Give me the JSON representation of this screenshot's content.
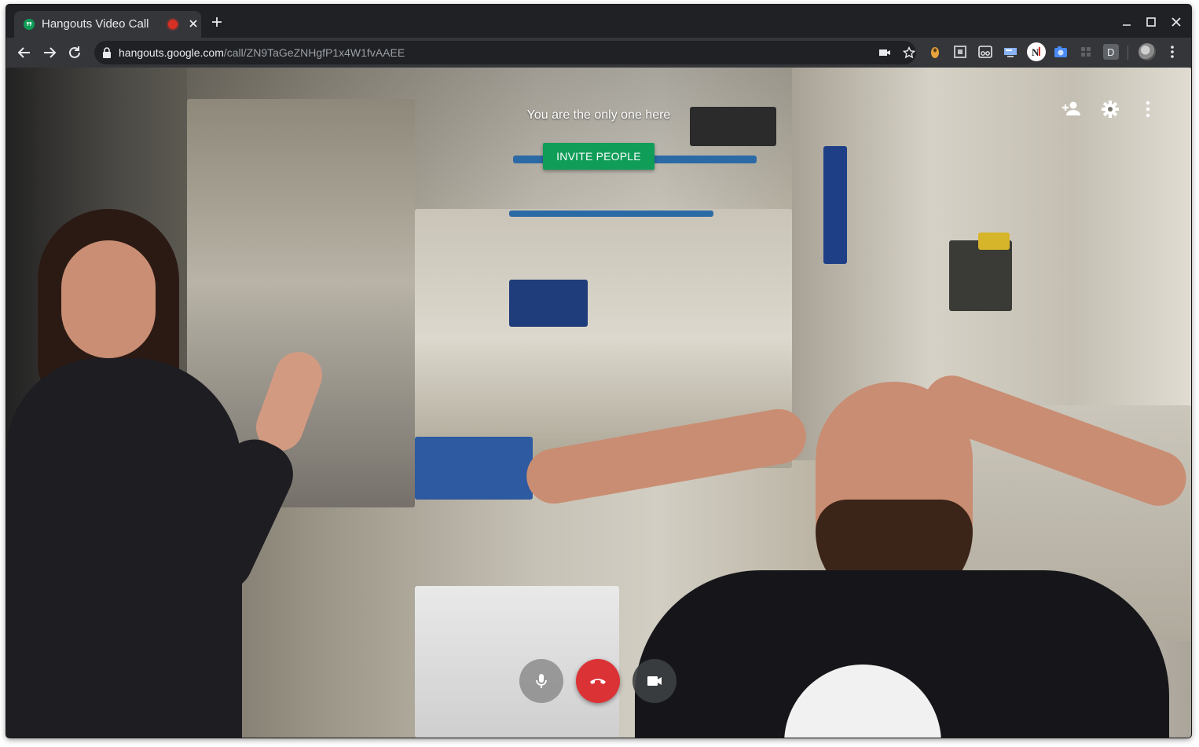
{
  "browser": {
    "tab_title": "Hangouts Video Call",
    "url_host": "hangouts.google.com",
    "url_path": "/call/ZN9TaGeZNHgfP1x4W1fvAAEE",
    "new_tab_icon": "plus-icon",
    "window_controls": [
      "minimize-icon",
      "maximize-icon",
      "close-icon"
    ],
    "nav_icons": [
      "back-arrow-icon",
      "forward-arrow-icon",
      "reload-icon"
    ],
    "omnibox_icons": [
      "lock-icon",
      "camera-in-use-icon",
      "star-icon"
    ],
    "extensions": [
      {
        "name": "honey-extension-icon",
        "color": "#e6a23c",
        "glyph": "●"
      },
      {
        "name": "screenshot-extension-icon",
        "color": "#bdc1c6",
        "glyph": "▣"
      },
      {
        "name": "glasses-extension-icon",
        "color": "#e8eaed",
        "glyph": "oo"
      },
      {
        "name": "screen-extension-icon",
        "color": "#8ab4f8",
        "glyph": "▭"
      },
      {
        "name": "news-extension-icon",
        "color": "#ffffff",
        "glyph": "N"
      },
      {
        "name": "camera-extension-icon",
        "color": "#4a8af4",
        "glyph": "◉"
      },
      {
        "name": "grid-extension-icon",
        "color": "#5f6368",
        "glyph": "⊞"
      },
      {
        "name": "d-extension-icon",
        "color": "#9aa0a6",
        "glyph": "D"
      }
    ]
  },
  "call": {
    "status_message": "You are the only one here",
    "invite_label": "INVITE PEOPLE",
    "accent_color": "#0f9d58",
    "hangup_color": "#db3236",
    "top_controls": [
      "add-person-icon",
      "gear-icon",
      "more-vert-icon"
    ],
    "bottom_controls": [
      "microphone-icon",
      "hang-up-icon",
      "video-camera-icon"
    ]
  }
}
